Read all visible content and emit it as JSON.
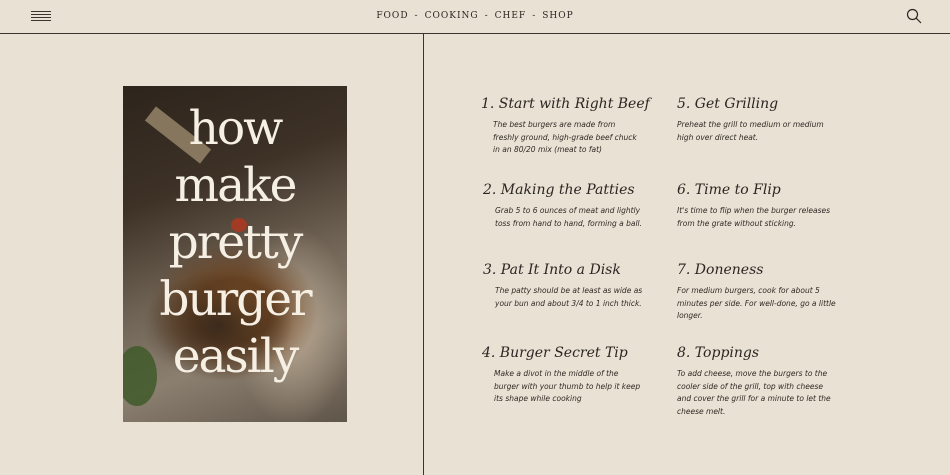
{
  "header": {
    "menu_icon": "hamburger-icon",
    "search_icon": "search-icon",
    "nav": [
      "FOOD",
      "COOKING",
      "CHEF",
      "SHOP"
    ],
    "separator": "-"
  },
  "poster": {
    "lines": [
      "how",
      "make",
      "pretty",
      "burger",
      "easily"
    ]
  },
  "steps": [
    {
      "title": "1. Start with Right Beef",
      "body": "The best burgers are made from freshly ground, high-grade beef chuck in an 80/20 mix (meat to fat)"
    },
    {
      "title": "2. Making the Patties",
      "body": "Grab 5 to 6 ounces of meat and lightly toss from hand to hand, forming a ball."
    },
    {
      "title": "3. Pat It Into a Disk",
      "body": "The patty should be at least as wide as your bun and about 3/4 to 1 inch thick."
    },
    {
      "title": "4. Burger Secret Tip",
      "body": "Make a divot in the middle of the burger with your thumb to help it keep its shape while cooking"
    },
    {
      "title": "5. Get Grilling",
      "body": "Preheat the grill to medium or medium high over direct heat."
    },
    {
      "title": "6. Time to Flip",
      "body": "It's time to flip when the burger releases from the grate without sticking."
    },
    {
      "title": "7. Doneness",
      "body": "For medium burgers, cook for about 5 minutes per side. For well-done, go a little longer."
    },
    {
      "title": "8. Toppings",
      "body": "To add cheese, move the burgers to the cooler side of the grill, top with cheese and cover the grill for a minute to let the cheese melt."
    }
  ]
}
